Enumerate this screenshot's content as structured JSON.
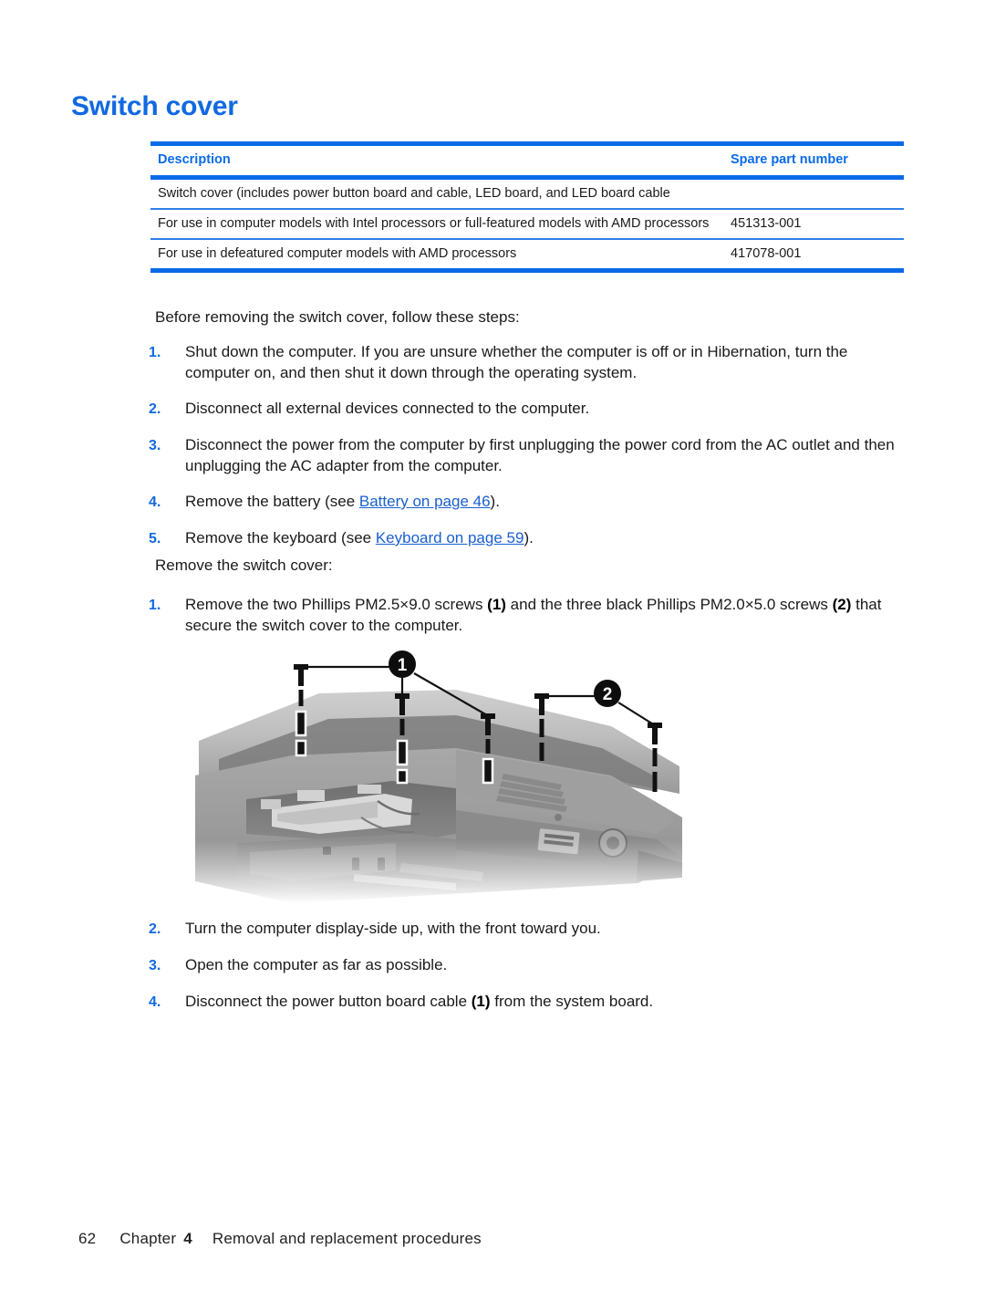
{
  "document": {
    "title": "Switch cover"
  },
  "parts_table": {
    "headers": {
      "description": "Description",
      "spare_part_number": "Spare part number"
    },
    "rows": [
      {
        "description": "Switch cover (includes power button board and cable, LED board, and LED board cable",
        "spare_part_number": ""
      },
      {
        "description": "For use in computer models with Intel processors or full-featured models with AMD processors",
        "spare_part_number": "451313-001"
      },
      {
        "description": "For use in defeatured computer models with AMD processors",
        "spare_part_number": "417078-001"
      }
    ]
  },
  "before_section": {
    "intro": "Before removing the switch cover, follow these steps:",
    "steps": [
      {
        "number": "1.",
        "text": "Shut down the computer. If you are unsure whether the computer is off or in Hibernation, turn the computer on, and then shut it down through the operating system."
      },
      {
        "number": "2.",
        "text": "Disconnect all external devices connected to the computer."
      },
      {
        "number": "3.",
        "text": "Disconnect the power from the computer by first unplugging the power cord from the AC outlet and then unplugging the AC adapter from the computer."
      },
      {
        "number": "4.",
        "prefix": "Remove the battery (see ",
        "link": "Battery on page 46",
        "suffix": ")."
      },
      {
        "number": "5.",
        "prefix": "Remove the keyboard (see ",
        "link": "Keyboard on page 59",
        "suffix": ")."
      }
    ]
  },
  "remove_section": {
    "intro": "Remove the switch cover:",
    "step1": {
      "number": "1.",
      "part_a": "Remove the two Phillips PM2.5×9.0 screws ",
      "callout_a": "(1)",
      "part_b": " and the three black Phillips PM2.0×5.0 screws ",
      "callout_b": "(2)",
      "part_c": " that secure the switch cover to the computer."
    },
    "steps_after": [
      {
        "number": "2.",
        "text": "Turn the computer display-side up, with the front toward you."
      },
      {
        "number": "3.",
        "text": "Open the computer as far as possible."
      },
      {
        "number": "4.",
        "prefix": "Disconnect the power button board cable ",
        "callout": "(1)",
        "suffix": " from the system board."
      }
    ]
  },
  "figure": {
    "caption": "",
    "callouts": [
      {
        "label": "1",
        "description": "two Phillips PM2.5x9.0 screws"
      },
      {
        "label": "2",
        "description": "three black Phillips PM2.0x5.0 screws"
      }
    ]
  },
  "footer": {
    "page_number": "62",
    "chapter_label": "Chapter",
    "chapter_number": "4",
    "chapter_title": "Removal and replacement procedures"
  },
  "colors": {
    "heading_blue": "#1169e0",
    "rule_blue": "#0a6ae8",
    "link_blue": "#1a5fd0"
  }
}
